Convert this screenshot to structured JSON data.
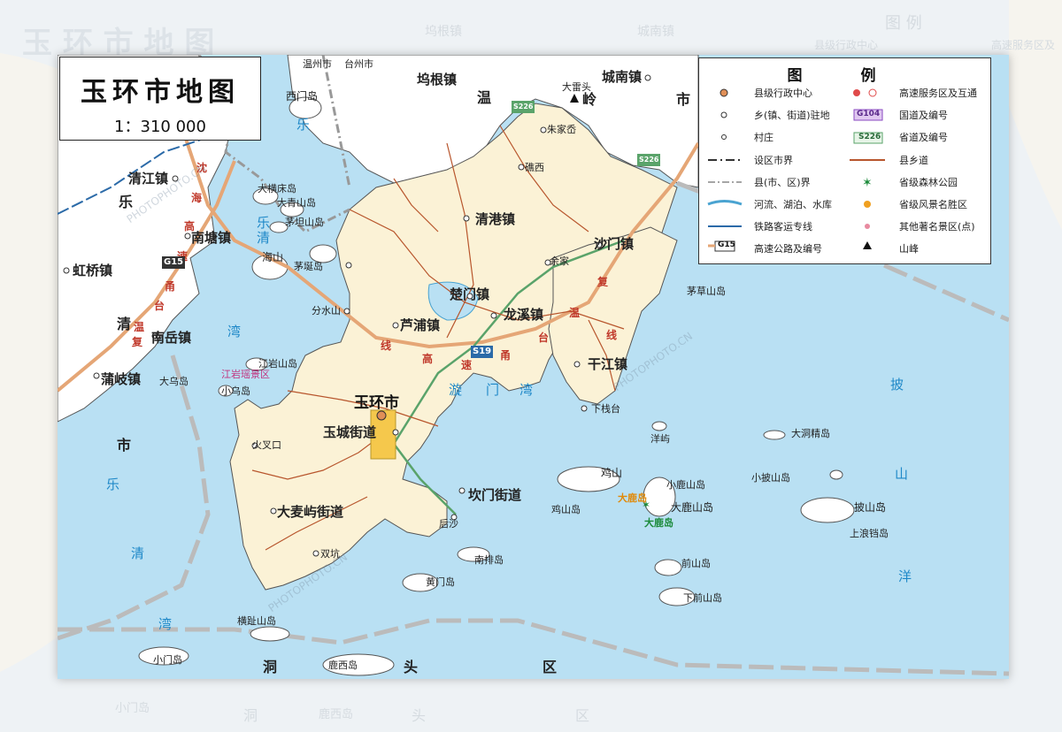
{
  "title": "玉环市地图",
  "scale": "1：310 000",
  "legend": {
    "heading": "图  例",
    "items_left": [
      "县级行政中心",
      "乡(镇、街道)驻地",
      "村庄",
      "设区市界",
      "县(市、区)界",
      "河流、湖泊、水库",
      "铁路客运专线",
      "高速公路及编号"
    ],
    "items_right": [
      "高速服务区及互通",
      "国道及编号",
      "省道及编号",
      "县乡道",
      "省级森林公园",
      "省级风景名胜区",
      "其他著名景区(点)",
      "山峰"
    ],
    "badges": {
      "g104": "G104",
      "s226": "S226",
      "g15": "G15"
    }
  },
  "labels": {
    "county_seat": "玉环市",
    "towns": [
      "玉城街道",
      "坎门街道",
      "大麦屿街道",
      "清港镇",
      "楚门镇",
      "龙溪镇",
      "沙门镇",
      "干江镇",
      "芦浦镇",
      "城南镇",
      "坞根镇",
      "清江镇",
      "南塘镇",
      "虹桥镇",
      "南岳镇",
      "蒲岐镇"
    ],
    "villages": [
      "朱家岙",
      "礁西",
      "余家",
      "分水山",
      "火叉口",
      "双坑",
      "后沙",
      "下栈台",
      "温州市",
      "台州市",
      "大雷头"
    ],
    "islands": [
      "西门岛",
      "大横床岛",
      "大青山岛",
      "茅坦山岛",
      "海山",
      "茅埏岛",
      "江岩山岛",
      "大乌岛",
      "小乌岛",
      "茅草山岛",
      "洋屿",
      "大洞精岛",
      "小披山岛",
      "鸡山",
      "小鹿山岛",
      "大鹿山岛",
      "鸡山岛",
      "披山岛",
      "上浪铛岛",
      "南排岛",
      "黄门岛",
      "前山岛",
      "下前山岛",
      "横趾山岛",
      "小门岛",
      "鹿西岛"
    ],
    "sea": [
      "乐",
      "清",
      "湾",
      "漩",
      "门",
      "湾",
      "披",
      "山",
      "洋",
      "市",
      "乐",
      "清",
      "湾"
    ],
    "region": [
      "温",
      "岭",
      "市",
      "乐",
      "清",
      "市",
      "洞",
      "头",
      "区"
    ],
    "highway_red": [
      "沈",
      "海",
      "高",
      "速",
      "甬",
      "台",
      "温",
      "复",
      "线",
      "高",
      "速",
      "甬",
      "台",
      "温",
      "复",
      "线"
    ],
    "scenic": [
      "大鹿岛",
      "大鹿岛",
      "江岩瑶景区"
    ],
    "roads": [
      "G15",
      "S19",
      "S226",
      "S226"
    ],
    "peak": "大雷头"
  },
  "watermark": "PHOTOPHOTO.CN"
}
